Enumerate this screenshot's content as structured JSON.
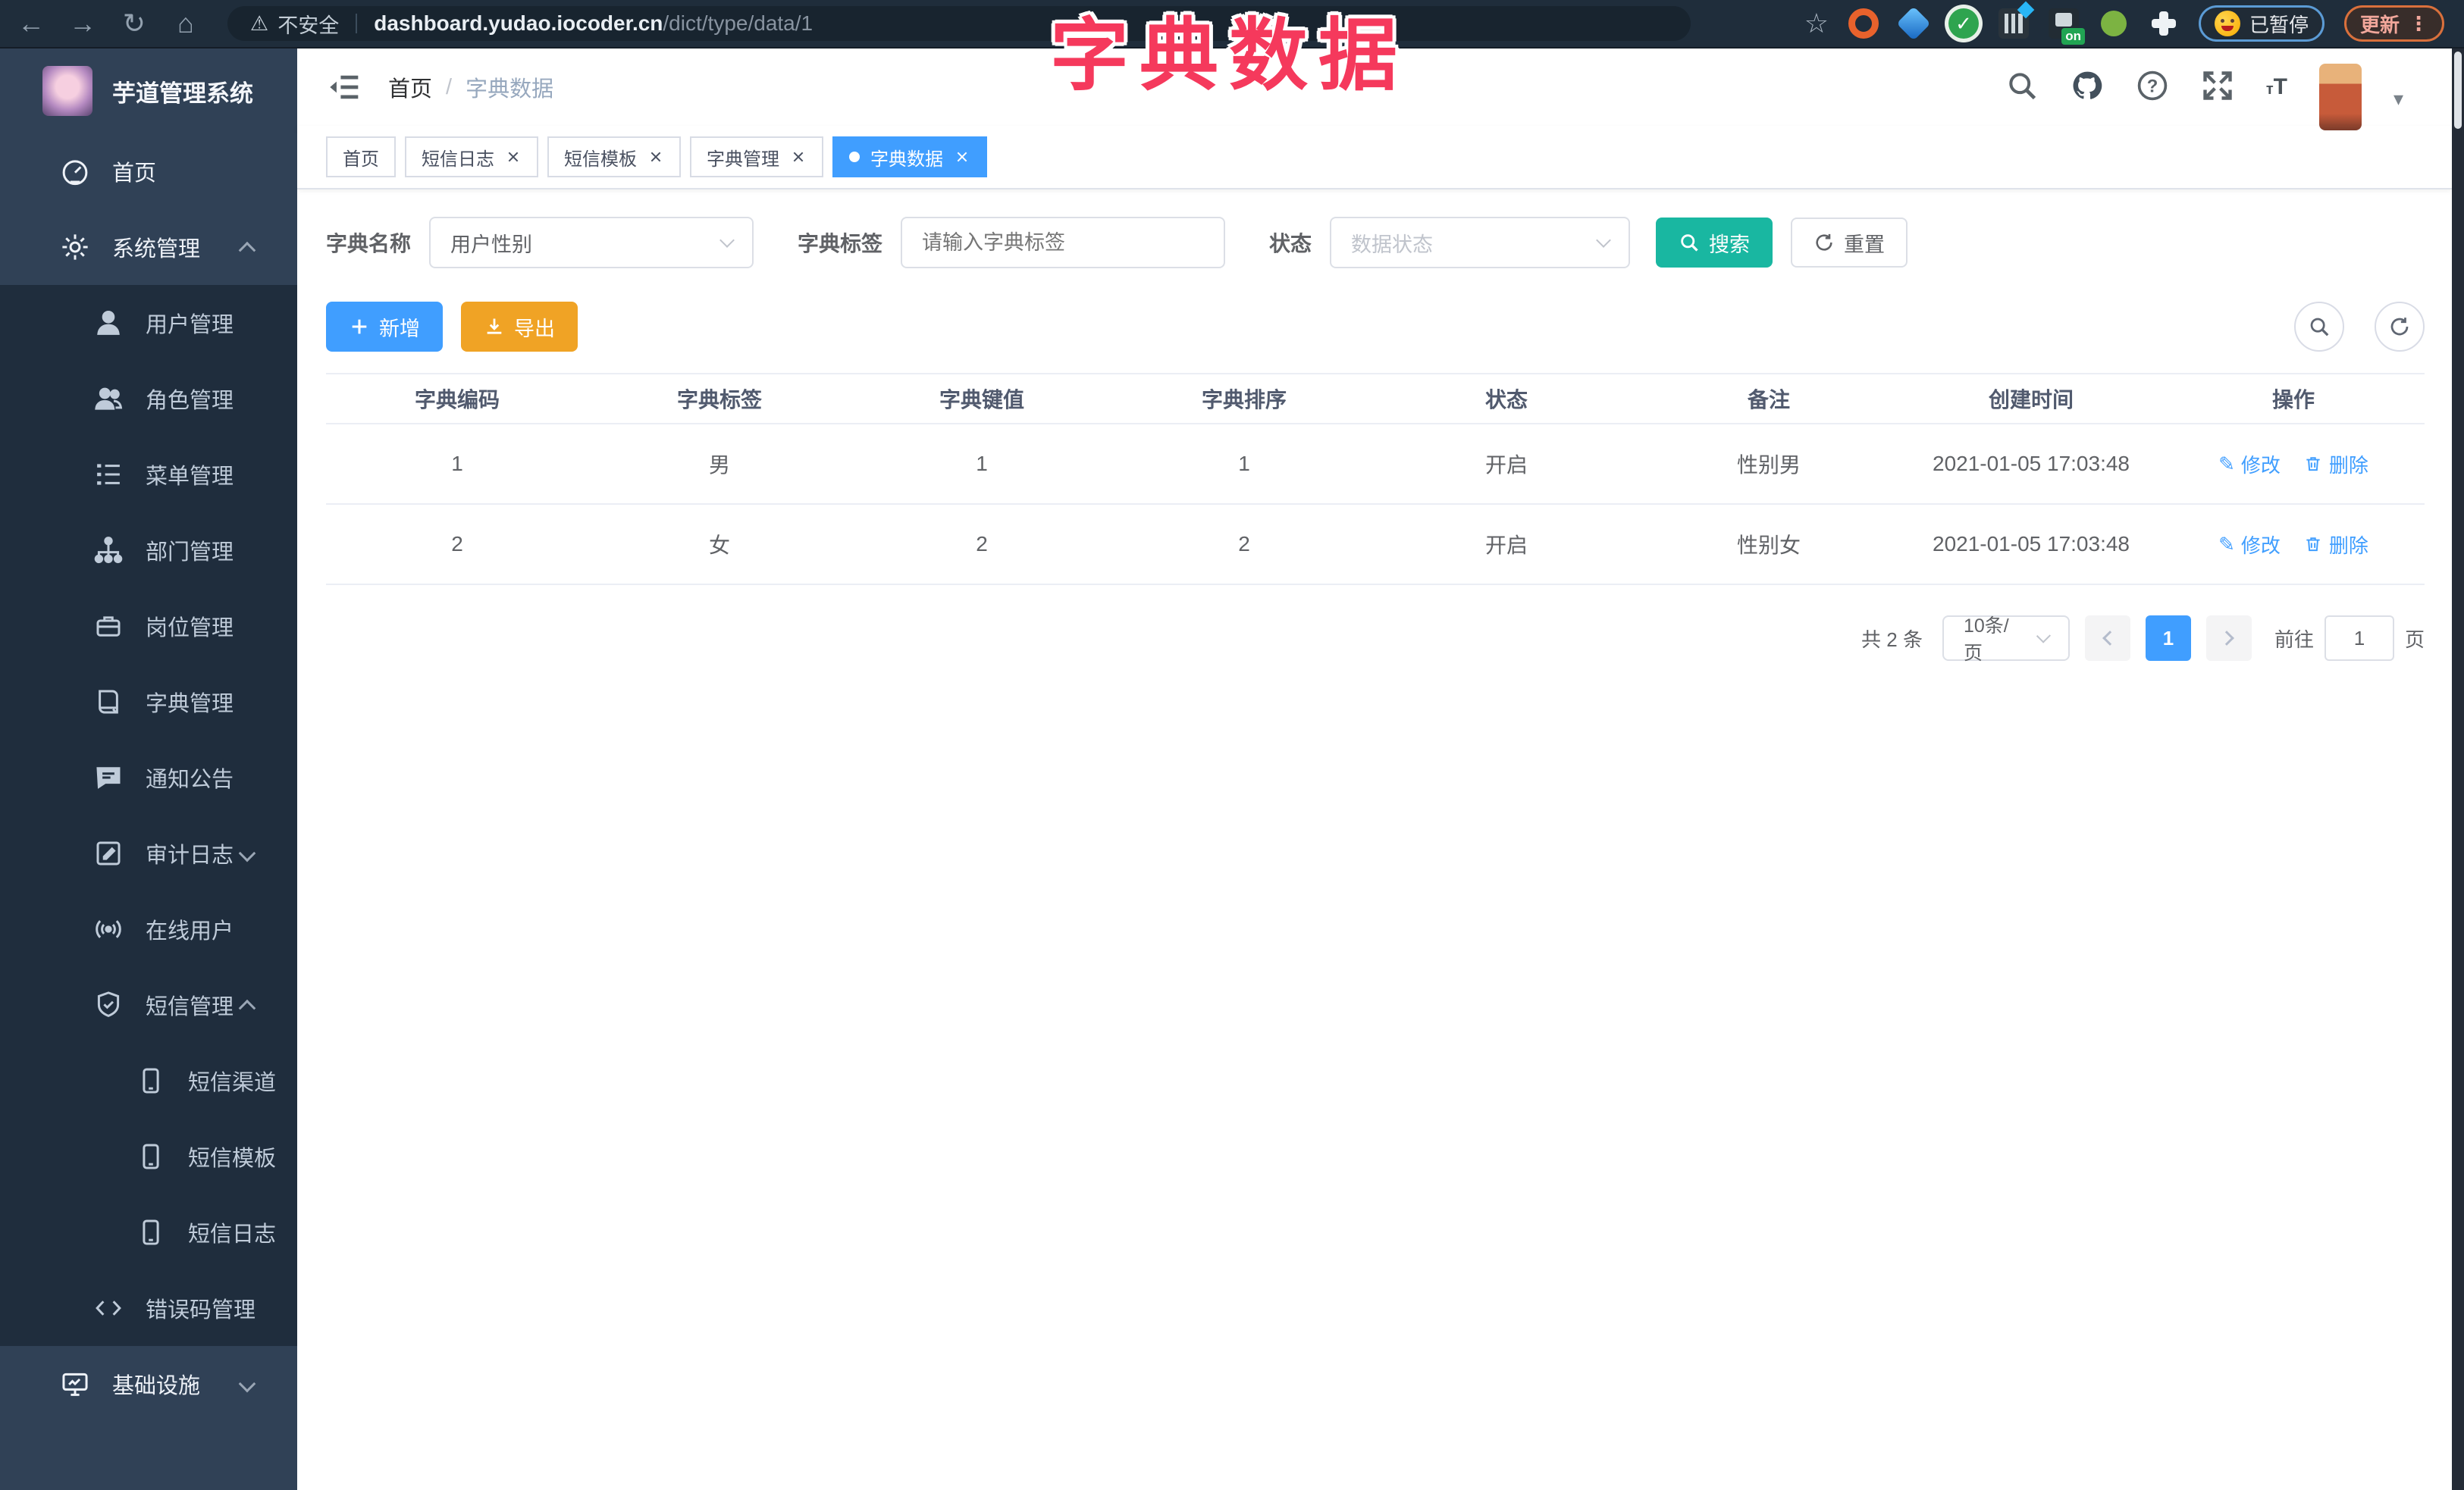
{
  "annotation": {
    "text": "字典数据",
    "color": "#f5395c"
  },
  "browser": {
    "security_label": "不安全",
    "url_host": "dashboard.yudao.iocoder.cn",
    "url_path": "/dict/type/data/1",
    "paused_badge": "已暂停",
    "update_label": "更新",
    "extension_on_badge": "on"
  },
  "icons": {
    "back": "←",
    "forward": "→",
    "reload": "↻",
    "home": "⌂",
    "warning": "⚠",
    "star": "☆",
    "dots": "⋮",
    "caret": "▾",
    "edit": "✎",
    "font_small": "т",
    "font_big": "T",
    "help": "?"
  },
  "sidebar": {
    "logo_title": "芋道管理系统",
    "items": [
      {
        "label": "首页",
        "icon": "dashboard-icon",
        "level": 0
      },
      {
        "label": "系统管理",
        "icon": "gear-icon",
        "level": 0,
        "arrow": "up"
      },
      {
        "label": "用户管理",
        "icon": "user-icon",
        "level": 1
      },
      {
        "label": "角色管理",
        "icon": "users-icon",
        "level": 1
      },
      {
        "label": "菜单管理",
        "icon": "menu-list-icon",
        "level": 1
      },
      {
        "label": "部门管理",
        "icon": "org-tree-icon",
        "level": 1
      },
      {
        "label": "岗位管理",
        "icon": "briefcase-icon",
        "level": 1
      },
      {
        "label": "字典管理",
        "icon": "dictionary-book-icon",
        "level": 1
      },
      {
        "label": "通知公告",
        "icon": "announcement-icon",
        "level": 1
      },
      {
        "label": "审计日志",
        "icon": "audit-log-icon",
        "level": 1,
        "arrow": "down"
      },
      {
        "label": "在线用户",
        "icon": "online-users-icon",
        "level": 1
      },
      {
        "label": "短信管理",
        "icon": "shield-check-icon",
        "level": 1,
        "arrow": "up"
      },
      {
        "label": "短信渠道",
        "icon": "phone-icon",
        "level": 2
      },
      {
        "label": "短信模板",
        "icon": "phone-icon",
        "level": 2
      },
      {
        "label": "短信日志",
        "icon": "phone-icon",
        "level": 2
      },
      {
        "label": "错误码管理",
        "icon": "code-icon",
        "level": 1
      },
      {
        "label": "基础设施",
        "icon": "monitor-icon",
        "level": 0,
        "arrow": "down"
      }
    ]
  },
  "header": {
    "breadcrumb_home": "首页",
    "breadcrumb_sep": "/",
    "breadcrumb_current": "字典数据"
  },
  "tabs": [
    {
      "label": "首页",
      "closable": false,
      "active": false
    },
    {
      "label": "短信日志",
      "closable": true,
      "active": false
    },
    {
      "label": "短信模板",
      "closable": true,
      "active": false
    },
    {
      "label": "字典管理",
      "closable": true,
      "active": false
    },
    {
      "label": "字典数据",
      "closable": true,
      "active": true
    }
  ],
  "filters": {
    "name_label": "字典名称",
    "name_value": "用户性别",
    "tag_label": "字典标签",
    "tag_placeholder": "请输入字典标签",
    "status_label": "状态",
    "status_placeholder": "数据状态",
    "search_label": "搜索",
    "reset_label": "重置"
  },
  "toolbar": {
    "add_label": "新增",
    "export_label": "导出"
  },
  "table": {
    "columns": [
      "字典编码",
      "字典标签",
      "字典键值",
      "字典排序",
      "状态",
      "备注",
      "创建时间",
      "操作"
    ],
    "rows": [
      {
        "code": "1",
        "label": "男",
        "value": "1",
        "sort": "1",
        "status": "开启",
        "remark": "性别男",
        "created": "2021-01-05 17:03:48"
      },
      {
        "code": "2",
        "label": "女",
        "value": "2",
        "sort": "2",
        "status": "开启",
        "remark": "性别女",
        "created": "2021-01-05 17:03:48"
      }
    ],
    "edit_label": "修改",
    "delete_label": "删除"
  },
  "pagination": {
    "total_text": "共 2 条",
    "page_size": "10条/页",
    "current_page": "1",
    "goto_label": "前往",
    "goto_value": "1",
    "page_unit": "页"
  },
  "colors": {
    "primary": "#409eff",
    "search_teal": "#19b7a1",
    "export_orange": "#f0a325",
    "sidebar_bg": "#304156",
    "submenu_bg": "#1f2d3d",
    "chrome_bg": "#1f2d3b",
    "annotation_red": "#f5395c"
  }
}
